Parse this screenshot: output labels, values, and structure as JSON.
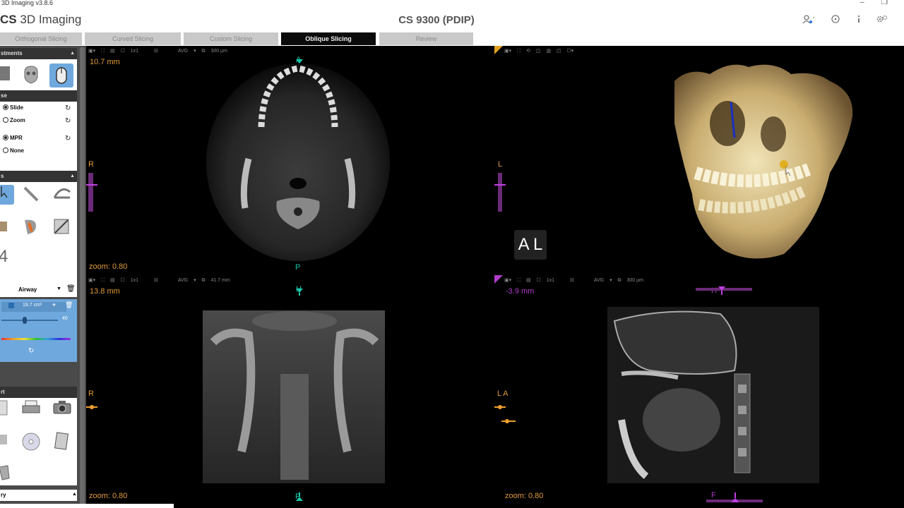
{
  "window": {
    "caption": "3D Imaging v3.8.6",
    "logo_prefix": "CS",
    "logo_text": "3D Imaging",
    "product": "CS 9300 (PDIP)",
    "minimize": "–",
    "restore": "❐"
  },
  "tabs": [
    {
      "label": "Orthogonal Slicing"
    },
    {
      "label": "Curved Slicing"
    },
    {
      "label": "Custom Slicing"
    },
    {
      "label": "Oblique Slicing"
    },
    {
      "label": "Review"
    }
  ],
  "left_panel": {
    "adjustments_header": "stments",
    "mouse_header": "se",
    "radio_slide": "Slide",
    "radio_zoom": "Zoom",
    "radio_mpr": "MPR",
    "radio_none": "None",
    "tools_header": "s",
    "number_4": "4",
    "airway_label": "Airway",
    "airway_volume": "19.7 cm³",
    "airway_slider_value": "40",
    "export_header": "rt",
    "footer_label": "ry"
  },
  "viewports": {
    "axial": {
      "layout": "1x1",
      "filter": "AVG",
      "thickness": "300 µm",
      "depth": "10.7 mm",
      "zoom": "zoom: 0.80",
      "left_label": "R",
      "top_label": "A",
      "bottom_label": "P"
    },
    "volume": {
      "left_label": "L",
      "cube_label": "A L"
    },
    "coronal": {
      "layout": "1x1",
      "filter": "AVG",
      "thickness": "41.7 mm",
      "depth": "13.8 mm",
      "zoom": "zoom: 0.80",
      "left_label": "R",
      "top_label": "H",
      "bottom_label": "F"
    },
    "sagittal": {
      "layout": "1x1",
      "filter": "AVG",
      "thickness": "300 µm",
      "depth": "-3.9 mm",
      "zoom": "zoom: 0.80",
      "left_label": "L A",
      "top_label": "H",
      "bottom_label": "F"
    }
  },
  "colors": {
    "label_orange": "#e09a3a",
    "marker_teal": "#18c8a8",
    "marker_magenta": "#b03cc8",
    "marker_orange": "#f0a030",
    "selection_blue": "#6fa8dc"
  }
}
